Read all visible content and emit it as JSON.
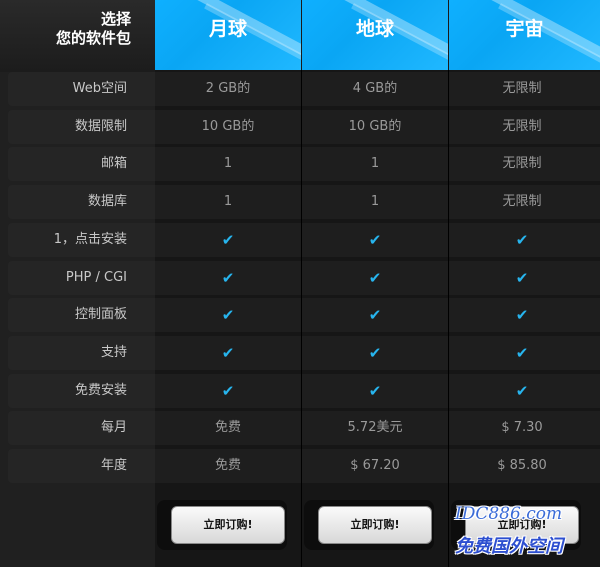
{
  "corner": {
    "line1": "选择",
    "line2": "您的软件包"
  },
  "plans": [
    "月球",
    "地球",
    "宇宙"
  ],
  "rows": [
    {
      "label": "Web空间",
      "values": [
        "2 GB的",
        "4 GB的",
        "无限制"
      ]
    },
    {
      "label": "数据限制",
      "values": [
        "10 GB的",
        "10 GB的",
        "无限制"
      ]
    },
    {
      "label": "邮箱",
      "values": [
        "1",
        "1",
        "无限制"
      ]
    },
    {
      "label": "数据库",
      "values": [
        "1",
        "1",
        "无限制"
      ]
    },
    {
      "label": "1，点击安装",
      "values": [
        "✔",
        "✔",
        "✔"
      ]
    },
    {
      "label": "PHP / CGI",
      "values": [
        "✔",
        "✔",
        "✔"
      ]
    },
    {
      "label": "控制面板",
      "values": [
        "✔",
        "✔",
        "✔"
      ]
    },
    {
      "label": "支持",
      "values": [
        "✔",
        "✔",
        "✔"
      ]
    },
    {
      "label": "免费安装",
      "values": [
        "✔",
        "✔",
        "✔"
      ]
    },
    {
      "label": "每月",
      "values": [
        "免费",
        "5.72美元",
        "$ 7.30"
      ]
    },
    {
      "label": "年度",
      "values": [
        "免费",
        "$ 67.20",
        "$ 85.80"
      ]
    }
  ],
  "order_button": "立即订购!",
  "watermark": {
    "line1": "IDC886.com",
    "line2": "免费国外空间"
  },
  "colors": {
    "accent": "#27b5ee",
    "header": "#0fb0ff"
  }
}
